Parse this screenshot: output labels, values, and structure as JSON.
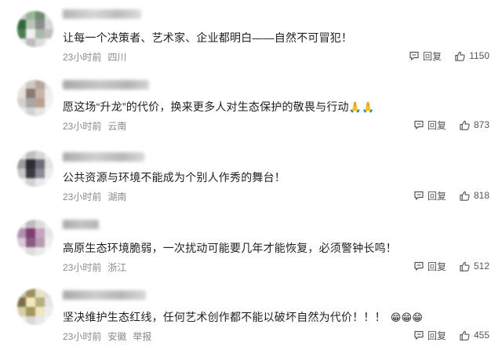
{
  "comments": [
    {
      "text": "让每一个决策者、艺术家、企业都明白——自然不可冒犯！",
      "time": "23小时前",
      "location": "四川",
      "reply_label": "回复",
      "likes": "1150",
      "avatar_colors": [
        "#c9c9c9",
        "#9ab39a",
        "#6d8f6d",
        "#e3e3e3",
        "#2f6a3a",
        "#b7c7b7",
        "#8c8c8c",
        "#d8d8d8",
        "#4d7d4d",
        "#f0f0f0",
        "#a9b9a9",
        "#c0c0c0",
        "#e8e8e8",
        "#bcbcbc",
        "#dcdcdc",
        "#f4f4f4"
      ]
    },
    {
      "text": "愿这场“升龙”的代价，换来更多人对生态保护的敬畏与行动",
      "emojis": "🙏🙏",
      "time": "23小时前",
      "location": "云南",
      "reply_label": "回复",
      "likes": "873",
      "avatar_colors": [
        "#e8e8e8",
        "#cfc9c4",
        "#b6a6a0",
        "#e0e0e0",
        "#e6e1dc",
        "#8a7a70",
        "#c9b2a7",
        "#efefef",
        "#d6d0cb",
        "#a8a8a8",
        "#b9a08f",
        "#f2f2f2",
        "#ececec",
        "#d4d4d4",
        "#e4e4e4",
        "#f7f7f7"
      ]
    },
    {
      "text": "公共资源与环境不能成为个别人作秀的舞台！",
      "time": "23小时前",
      "location": "湖南",
      "reply_label": "回复",
      "likes": "818",
      "avatar_colors": [
        "#e5e5e5",
        "#bfbfbf",
        "#d7d7d7",
        "#f0f0f0",
        "#9c9c9c",
        "#2c2c34",
        "#6e6e7a",
        "#e2e2e2",
        "#c7c7c7",
        "#3a3a46",
        "#8b8b96",
        "#ededed",
        "#efefef",
        "#d1d1d1",
        "#e9e9e9",
        "#f6f6f6"
      ]
    },
    {
      "text": "高原生态环境脆弱，一次扰动可能要几年才能恢复，必须警钟长鸣！",
      "time": "23小时前",
      "location": "浙江",
      "reply_label": "回复",
      "likes": "512",
      "avatar_colors": [
        "#e8e8e8",
        "#c4b7c4",
        "#dcdcdc",
        "#f1f1f1",
        "#b58fb0",
        "#7d3f6f",
        "#c7a3c0",
        "#e6e6e6",
        "#d8c9d6",
        "#8a5a82",
        "#b69ab2",
        "#efefef",
        "#f2f2f2",
        "#dddddd",
        "#ebebeb",
        "#f7f7f7"
      ]
    },
    {
      "text": "坚决维护生态红线，任何艺术创作都不能以破坏自然为代价！！！",
      "emojis": "😁😁😁",
      "time": "23小时前",
      "location": "安徽",
      "extra_label": "举报",
      "reply_label": "回复",
      "likes": "455",
      "avatar_colors": [
        "#c8c0a0",
        "#9c8f5f",
        "#e9e2c4",
        "#dcdcdc",
        "#7d7048",
        "#f2e9b8",
        "#b8ad80",
        "#e6e6e6",
        "#d7cfa6",
        "#a49660",
        "#efe7c0",
        "#ededed",
        "#f0f0f0",
        "#d8d8d8",
        "#e8e8e8",
        "#f6f6f6"
      ]
    }
  ]
}
